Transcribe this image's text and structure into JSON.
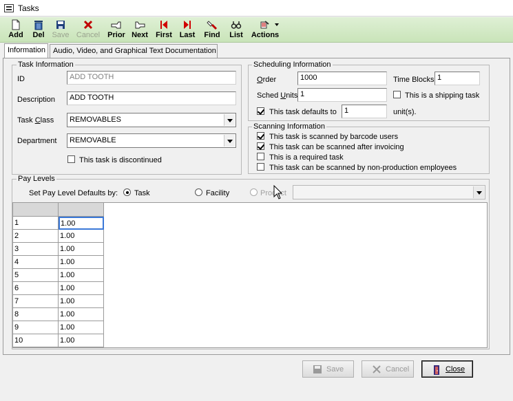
{
  "window": {
    "title": "Tasks"
  },
  "toolbar": {
    "add": "Add",
    "del": "Del",
    "save": "Save",
    "cancel": "Cancel",
    "prior": "Prior",
    "next": "Next",
    "first": "First",
    "last": "Last",
    "find": "Find",
    "list": "List",
    "actions": "Actions"
  },
  "tabs": [
    {
      "label": "Information",
      "active": true
    },
    {
      "label": "Audio, Video, and Graphical Text Documentation",
      "active": false
    }
  ],
  "task_info": {
    "legend": "Task Information",
    "id_label": "ID",
    "id_value": "ADD TOOTH",
    "description_label": "Description",
    "description_value": "ADD TOOTH",
    "task_class_label": "Task Class",
    "task_class_value": "REMOVABLES",
    "department_label": "Department",
    "department_value": "REMOVABLE",
    "discontinued_label": "This task is discontinued",
    "discontinued": false
  },
  "scheduling": {
    "legend": "Scheduling Information",
    "order_label": "Order",
    "order_value": "1000",
    "time_blocks_label": "Time Blocks",
    "time_blocks_value": "1",
    "sched_units_label": "Sched Units",
    "sched_units_value": "1",
    "shipping_label": "This is a shipping task",
    "shipping": false,
    "defaults_label": "This task defaults to",
    "defaults_checked": true,
    "defaults_value": "1",
    "units_suffix": "unit(s)."
  },
  "scanning": {
    "legend": "Scanning Information",
    "items": [
      {
        "label": "This task is scanned by barcode users",
        "checked": true
      },
      {
        "label": "This task can be scanned after invoicing",
        "checked": true
      },
      {
        "label": "This is a required task",
        "checked": false
      },
      {
        "label": "This task can be scanned by non-production employees",
        "checked": false
      }
    ]
  },
  "pay_levels": {
    "legend": "Pay Levels",
    "set_defaults_label": "Set Pay Level Defaults by:",
    "options": {
      "task": "Task",
      "facility": "Facility",
      "product": "Product"
    },
    "selected": "Task",
    "rows": [
      {
        "level": "1",
        "value": "1.00"
      },
      {
        "level": "2",
        "value": "1.00"
      },
      {
        "level": "3",
        "value": "1.00"
      },
      {
        "level": "4",
        "value": "1.00"
      },
      {
        "level": "5",
        "value": "1.00"
      },
      {
        "level": "6",
        "value": "1.00"
      },
      {
        "level": "7",
        "value": "1.00"
      },
      {
        "level": "8",
        "value": "1.00"
      },
      {
        "level": "9",
        "value": "1.00"
      },
      {
        "level": "10",
        "value": "1.00"
      }
    ]
  },
  "footer": {
    "save": "Save",
    "cancel": "Cancel",
    "close": "Close"
  }
}
